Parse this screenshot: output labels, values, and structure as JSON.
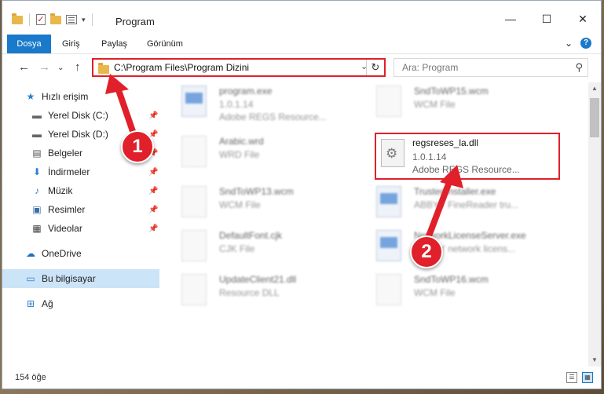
{
  "window": {
    "title": "Program",
    "controls": {
      "minimize": "—",
      "maximize": "☐",
      "close": "✕"
    }
  },
  "quick_access_toolbar": {
    "dropdown_glyph": "▾"
  },
  "ribbon": {
    "tabs": [
      {
        "label": "Dosya",
        "active": true
      },
      {
        "label": "Giriş"
      },
      {
        "label": "Paylaş"
      },
      {
        "label": "Görünüm"
      }
    ],
    "expand_glyph": "⌄",
    "help_glyph": "?"
  },
  "navigation": {
    "back": "←",
    "forward": "→",
    "recent": "⌄",
    "up": "↑"
  },
  "address_bar": {
    "path": "C:\\Program Files\\Program Dizini",
    "dropdown_glyph": "⌄",
    "refresh_glyph": "↻"
  },
  "search": {
    "placeholder": "Ara: Program",
    "icon_glyph": "⚲"
  },
  "sidebar": {
    "items": [
      {
        "label": "Hızlı erişim",
        "icon": "star-icon",
        "glyph": "★",
        "pinned": false
      },
      {
        "label": "Yerel Disk (C:)",
        "icon": "drive-icon",
        "glyph": "▬",
        "pinned": true
      },
      {
        "label": "Yerel Disk (D:)",
        "icon": "drive-icon",
        "glyph": "▬",
        "pinned": true
      },
      {
        "label": "Belgeler",
        "icon": "documents-icon",
        "glyph": "▤",
        "pinned": true
      },
      {
        "label": "İndirmeler",
        "icon": "download-icon",
        "glyph": "⬇",
        "pinned": true
      },
      {
        "label": "Müzik",
        "icon": "music-icon",
        "glyph": "♪",
        "pinned": true
      },
      {
        "label": "Resimler",
        "icon": "pictures-icon",
        "glyph": "▣",
        "pinned": true
      },
      {
        "label": "Videolar",
        "icon": "video-icon",
        "glyph": "▦",
        "pinned": true
      },
      {
        "label": "OneDrive",
        "icon": "cloud-icon",
        "glyph": "☁",
        "pinned": false
      },
      {
        "label": "Bu bilgisayar",
        "icon": "computer-icon",
        "glyph": "▭",
        "pinned": false,
        "selected": true
      },
      {
        "label": "Ağ",
        "icon": "network-icon",
        "glyph": "⊞",
        "pinned": false
      }
    ],
    "pin_glyph": "📌"
  },
  "files": [
    {
      "name": "program.exe",
      "line1": "1.0.1.14",
      "line2": "Adobe REGS Resource...",
      "type": "exe"
    },
    {
      "name": "SndToWP15.wcm",
      "line1": "WCM File",
      "line2": "",
      "type": "doc"
    },
    {
      "name": "Arabic.wrd",
      "line1": "WRD File",
      "line2": "",
      "type": "doc"
    },
    {
      "name": "regsreses_la.dll",
      "line1": "1.0.1.14",
      "line2": "Adobe REGS Resource...",
      "type": "dll"
    },
    {
      "name": "SndToWP13.wcm",
      "line1": "WCM File",
      "line2": "",
      "type": "doc"
    },
    {
      "name": "TrustedInstaller.exe",
      "line1": "ABBYY FineReader tru...",
      "line2": "",
      "type": "exe"
    },
    {
      "name": "DefaultFont.cjk",
      "line1": "CJK File",
      "line2": "",
      "type": "doc"
    },
    {
      "name": "NetworkLicenseServer.exe",
      "line1": "ABBYY network licens...",
      "line2": "",
      "type": "exe"
    },
    {
      "name": "UpdateClient21.dll",
      "line1": "Resource DLL",
      "line2": "",
      "type": "dll"
    },
    {
      "name": "SndToWP16.wcm",
      "line1": "WCM File",
      "line2": "",
      "type": "doc"
    }
  ],
  "status_bar": {
    "item_count": "154 öğe"
  },
  "annotations": [
    {
      "number": "1"
    },
    {
      "number": "2"
    }
  ],
  "colors": {
    "accent": "#1979ca",
    "highlight": "#e0202a",
    "selected_bg": "#cce4f7"
  }
}
